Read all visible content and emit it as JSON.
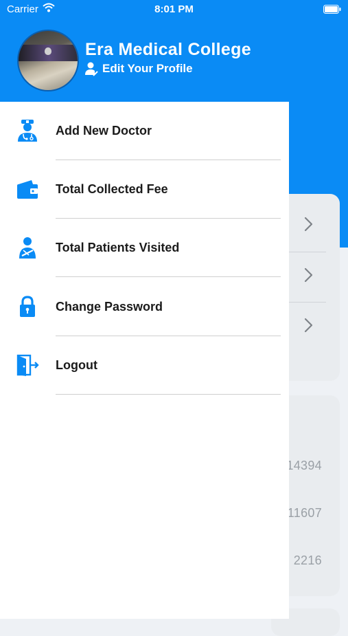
{
  "status_bar": {
    "carrier": "Carrier",
    "time": "8:01 PM"
  },
  "drawer": {
    "title": "Era Medical College",
    "edit_profile_label": "Edit Your Profile",
    "items": [
      {
        "label": "Add New Doctor",
        "icon": "doctor-icon"
      },
      {
        "label": "Total Collected Fee",
        "icon": "wallet-icon"
      },
      {
        "label": "Total Patients Visited",
        "icon": "patient-icon"
      },
      {
        "label": "Change Password",
        "icon": "lock-icon"
      },
      {
        "label": "Logout",
        "icon": "logout-icon"
      }
    ]
  },
  "background": {
    "numbers": [
      "14394",
      "11607",
      "2216"
    ]
  },
  "colors": {
    "primary": "#0a8bf5",
    "drawer_bg": "#ffffff",
    "text": "#1b1b1b"
  }
}
